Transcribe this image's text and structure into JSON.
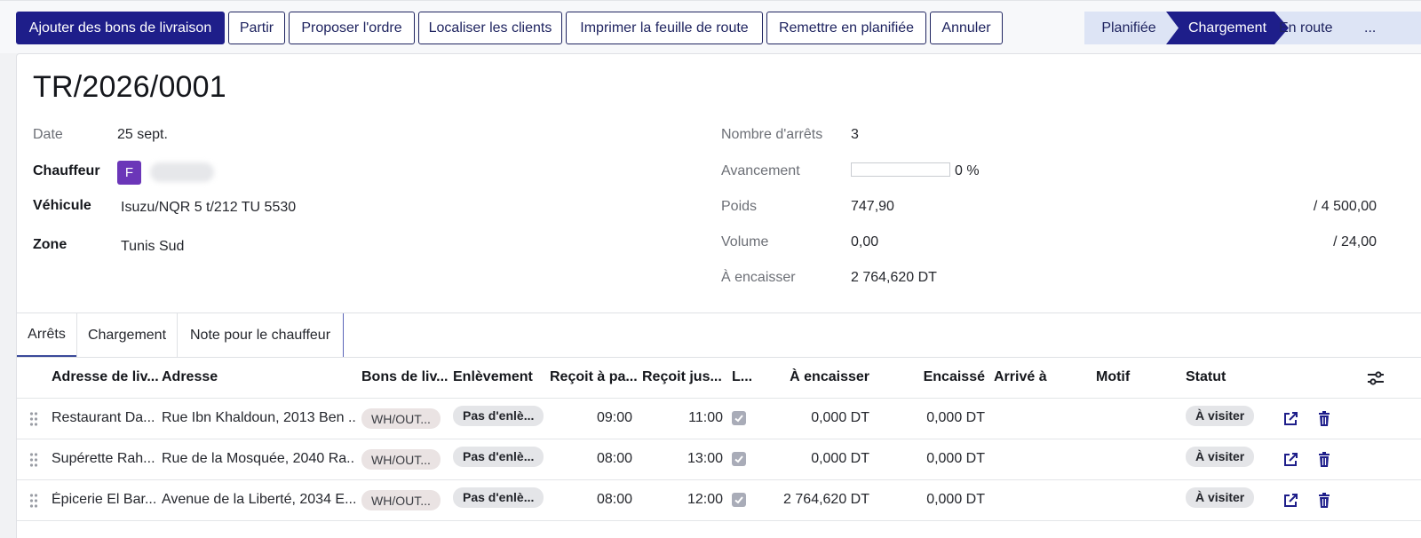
{
  "toolbar": {
    "add_delivery_notes": "Ajouter des bons de livraison",
    "leave": "Partir",
    "propose_order": "Proposer l'ordre",
    "locate_clients": "Localiser les clients",
    "print_route_sheet": "Imprimer la feuille de route",
    "reset_planned": "Remettre en planifiée",
    "cancel": "Annuler"
  },
  "statusbar": {
    "stages": [
      "Planifiée",
      "Chargement",
      "En route",
      "..."
    ],
    "active": "Chargement"
  },
  "record": {
    "title": "TR/2026/0001",
    "date_label": "Date",
    "date_value": "25 sept.",
    "driver_label": "Chauffeur",
    "driver_initial": "F",
    "vehicle_label": "Véhicule",
    "vehicle_value": "Isuzu/NQR 5 t/212 TU 5530",
    "zone_label": "Zone",
    "zone_value": "Tunis Sud",
    "stops_label": "Nombre d'arrêts",
    "stops_value": "3",
    "progress_label": "Avancement",
    "progress_text": "0 %",
    "progress_fraction": 0,
    "weight_label": "Poids",
    "weight_value": "747,90",
    "weight_max": "/ 4 500,00",
    "volume_label": "Volume",
    "volume_value": "0,00",
    "volume_max": "/ 24,00",
    "collect_label": "À encaisser",
    "collect_value": "2 764,620 DT"
  },
  "tabs": [
    "Arrêts",
    "Chargement",
    "Note pour le chauffeur"
  ],
  "table": {
    "headers": {
      "delivery_address": "Adresse de liv...",
      "address": "Adresse",
      "delivery_notes": "Bons de liv...",
      "pickup": "Enlèvement",
      "receives_from": "Reçoit à pa...",
      "receives_until": "Reçoit jus...",
      "l": "L...",
      "to_collect": "À encaisser",
      "collected": "Encaissé",
      "arrived_at": "Arrivé à",
      "reason": "Motif",
      "status": "Statut"
    },
    "rows": [
      {
        "delivery_address": "Restaurant Da...",
        "address": "Rue Ibn Khaldoun, 2013 Ben ...",
        "delivery_note": "WH/OUT...",
        "pickup": "Pas d'enlè...",
        "from": "09:00",
        "until": "11:00",
        "to_collect": "0,000 DT",
        "collected": "0,000 DT",
        "status": "À visiter"
      },
      {
        "delivery_address": "Supérette Rah...",
        "address": "Rue de la Mosquée, 2040 Ra...",
        "delivery_note": "WH/OUT...",
        "pickup": "Pas d'enlè...",
        "from": "08:00",
        "until": "13:00",
        "to_collect": "0,000 DT",
        "collected": "0,000 DT",
        "status": "À visiter"
      },
      {
        "delivery_address": "Épicerie El Bar...",
        "address": "Avenue de la Liberté, 2034 E...",
        "delivery_note": "WH/OUT...",
        "pickup": "Pas d'enlè...",
        "from": "08:00",
        "until": "12:00",
        "to_collect": "2 764,620 DT",
        "collected": "0,000 DT",
        "status": "À visiter"
      }
    ]
  },
  "icons": {
    "open": "external-link-icon",
    "delete": "trash-icon",
    "handle": "drag-handle-icon",
    "settings": "column-settings-icon"
  },
  "colors": {
    "primary": "#1e1e8a",
    "avatar": "#6b36b8",
    "statusbar_bg": "#dde4f5",
    "delete_icon": "#1e1e8a"
  }
}
